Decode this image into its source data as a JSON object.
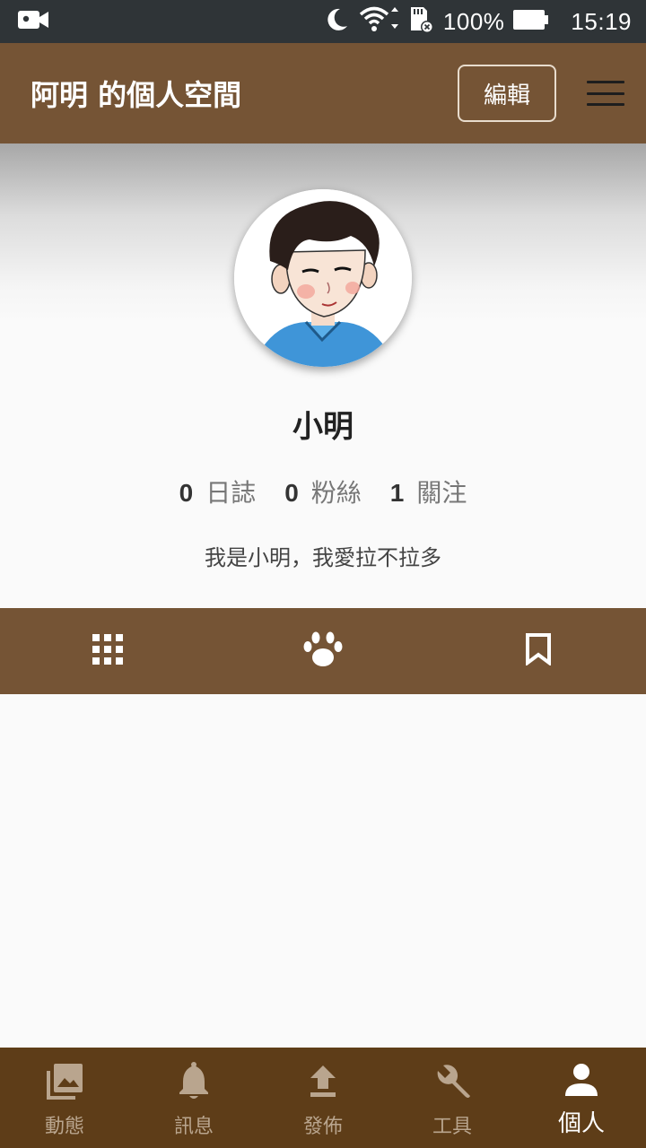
{
  "status_bar": {
    "battery": "100%",
    "time": "15:19"
  },
  "header": {
    "title": "阿明 的個人空間",
    "edit_label": "編輯"
  },
  "profile": {
    "name": "小明",
    "stats": [
      {
        "count": "0",
        "label": "日誌"
      },
      {
        "count": "0",
        "label": "粉絲"
      },
      {
        "count": "1",
        "label": "關注"
      }
    ],
    "bio": "我是小明，我愛拉不拉多"
  },
  "profile_tabs": [
    {
      "icon": "grid-icon"
    },
    {
      "icon": "paw-icon"
    },
    {
      "icon": "bookmark-icon"
    }
  ],
  "bottom_nav": [
    {
      "label": "動態",
      "icon": "photo-library-icon"
    },
    {
      "label": "訊息",
      "icon": "bell-icon"
    },
    {
      "label": "發佈",
      "icon": "upload-icon"
    },
    {
      "label": "工具",
      "icon": "wrench-icon"
    },
    {
      "label": "個人",
      "icon": "person-icon",
      "active": true
    }
  ],
  "colors": {
    "app_bar": "#755435",
    "bottom_nav": "#5e3d18",
    "status_bar": "#2f3437"
  }
}
